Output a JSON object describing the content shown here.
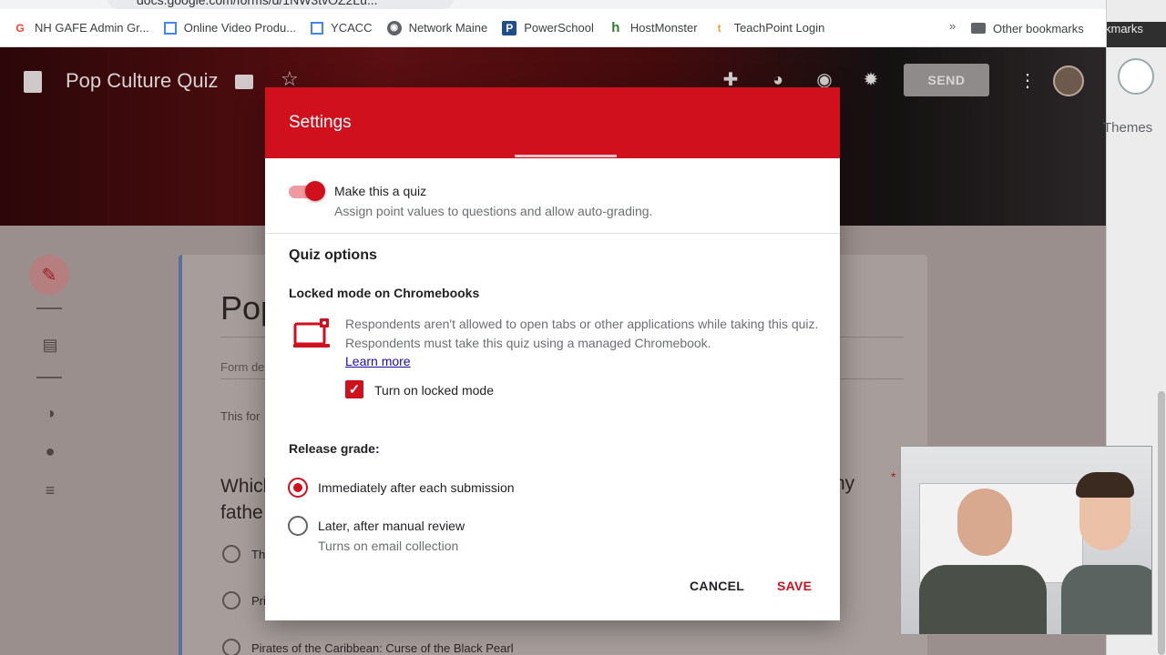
{
  "browser": {
    "url_fragment": "docs.google.com/forms/d/1NW3tvOZ2Lu...",
    "bookmarks": [
      {
        "label": "NH GAFE Admin Gr...",
        "icon": "google-icon",
        "color": "#4285f4"
      },
      {
        "label": "Online Video Produ...",
        "icon": "doc-icon",
        "color": "#4285f4"
      },
      {
        "label": "YCACC",
        "icon": "doc-icon",
        "color": "#4285f4"
      },
      {
        "label": "Network Maine",
        "icon": "globe-icon",
        "color": "#5f6368"
      },
      {
        "label": "PowerSchool",
        "icon": "powerschool-icon",
        "color": "#1f4e8c"
      },
      {
        "label": "HostMonster",
        "icon": "hostmonster-icon",
        "color": "#2e7d32"
      },
      {
        "label": "TeachPoint Login",
        "icon": "teachpoint-icon",
        "color": "#e6a23c"
      }
    ],
    "more_symbol": "»",
    "other_bookmarks": "Other bookmarks"
  },
  "header": {
    "form_title": "Pop Culture Quiz",
    "send_label": "SEND"
  },
  "side_panel": {
    "marks_text": "kmarks",
    "themes_label": "Themes"
  },
  "form_card": {
    "title_partial": "Pop",
    "desc_partial": "Form de",
    "note_partial": "This for",
    "question_partial": "Which fathe",
    "question_right_partial": "ny",
    "required_mark": "*",
    "options": [
      "The",
      "Pri",
      "Pirates of the Caribbean: Curse of the Black Pearl"
    ]
  },
  "settings": {
    "title": "Settings",
    "make_quiz_label": "Make this a quiz",
    "make_quiz_sub": "Assign point values to questions and allow auto-grading.",
    "quiz_options_head": "Quiz options",
    "locked_mode_head": "Locked mode on Chromebooks",
    "locked_mode_text": "Respondents aren't allowed to open tabs or other applications while taking this quiz. Respondents must take this quiz using a managed Chromebook.",
    "learn_more": "Learn more",
    "locked_checkbox_label": "Turn on locked mode",
    "release_head": "Release grade:",
    "release_immediate": "Immediately after each submission",
    "release_later": "Later, after manual review",
    "release_later_sub": "Turns on email collection",
    "cancel_label": "CANCEL",
    "save_label": "SAVE",
    "accent": "#d0101d"
  }
}
